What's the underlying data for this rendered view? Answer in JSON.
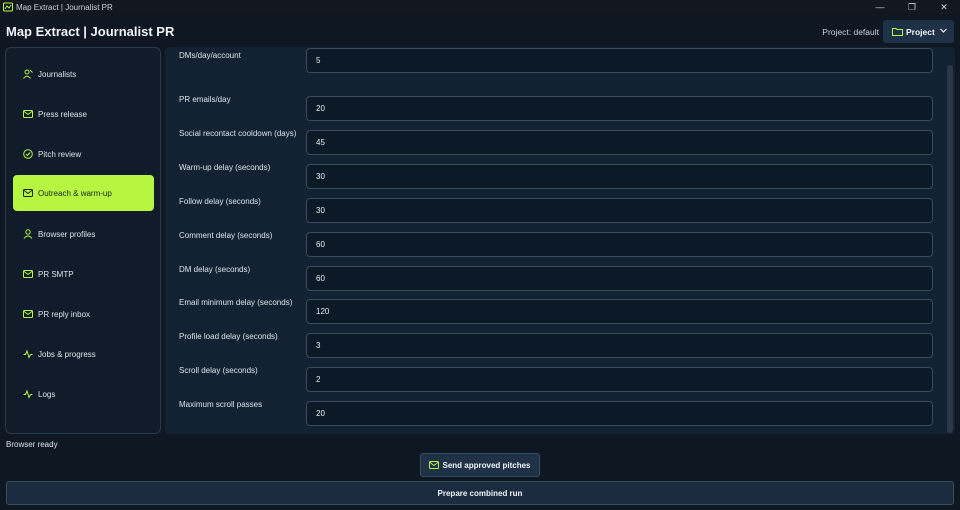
{
  "window": {
    "title": "Map Extract | Journalist PR",
    "controls": [
      "—",
      "❐",
      "✕"
    ]
  },
  "header": {
    "app_title": "Map Extract | Journalist PR",
    "project_label": "Project: default",
    "project_button": "Project"
  },
  "sidebar": {
    "items": [
      {
        "label": "Journalists",
        "icon": "journalist-icon"
      },
      {
        "label": "Press release",
        "icon": "mail-icon"
      },
      {
        "label": "Pitch review",
        "icon": "check-circle-icon"
      },
      {
        "label": "Outreach & warm-up",
        "icon": "mail-icon",
        "active": true
      },
      {
        "label": "Browser profiles",
        "icon": "user-icon"
      },
      {
        "label": "PR SMTP",
        "icon": "mail-icon"
      },
      {
        "label": "PR reply inbox",
        "icon": "mail-icon"
      },
      {
        "label": "Jobs & progress",
        "icon": "activity-icon"
      },
      {
        "label": "Logs",
        "icon": "activity-icon"
      }
    ]
  },
  "settings": [
    {
      "label": "DMs/day/account",
      "value": "5"
    },
    {
      "label": "PR emails/day",
      "value": "20"
    },
    {
      "label": "Social recontact cooldown (days)",
      "value": "45"
    },
    {
      "label": "Warm-up delay (seconds)",
      "value": "30"
    },
    {
      "label": "Follow delay (seconds)",
      "value": "30"
    },
    {
      "label": "Comment delay (seconds)",
      "value": "60"
    },
    {
      "label": "DM delay (seconds)",
      "value": "60"
    },
    {
      "label": "Email minimum delay (seconds)",
      "value": "120"
    },
    {
      "label": "Profile load delay (seconds)",
      "value": "3"
    },
    {
      "label": "Scroll delay (seconds)",
      "value": "2"
    },
    {
      "label": "Maximum scroll passes",
      "value": "20"
    }
  ],
  "status": "Browser ready",
  "actions": {
    "send": "Send approved pitches",
    "prepare": "Prepare combined run"
  },
  "colors": {
    "accent": "#b6f542",
    "background": "#0e1722",
    "panel": "#132233"
  }
}
